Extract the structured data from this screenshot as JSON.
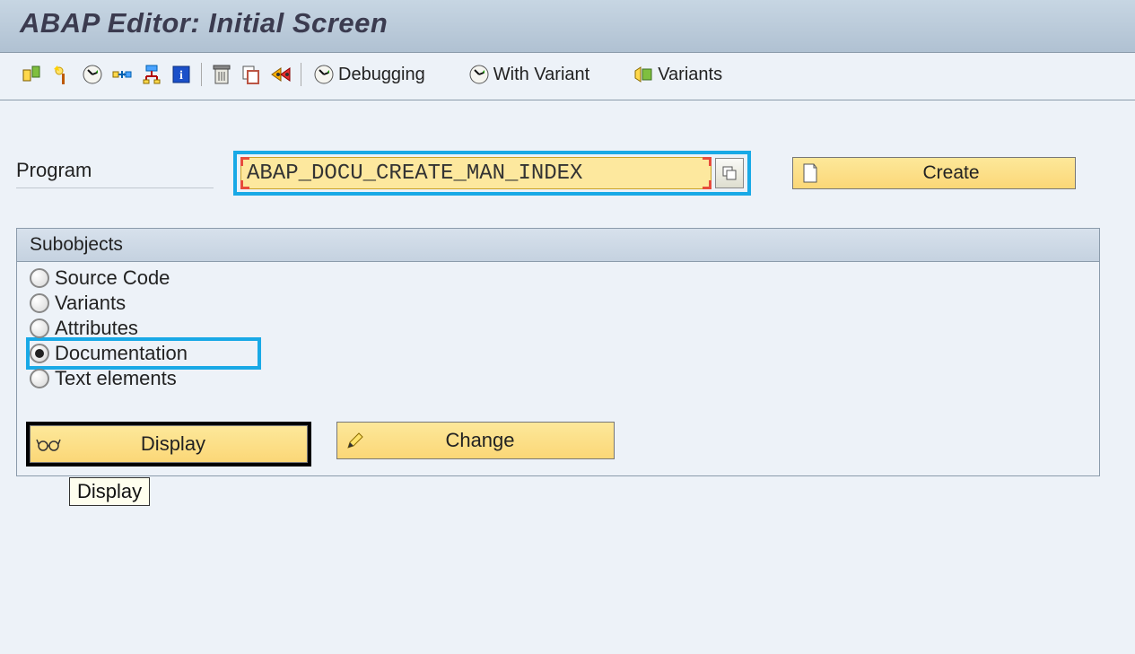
{
  "title": "ABAP Editor: Initial Screen",
  "toolbar": {
    "debugging_label": "Debugging",
    "with_variant_label": "With Variant",
    "variants_label": "Variants"
  },
  "program": {
    "label": "Program",
    "value": "ABAP_DOCU_CREATE_MAN_INDEX"
  },
  "create_button_label": "Create",
  "subobjects": {
    "header": "Subobjects",
    "options": [
      {
        "label": "Source Code",
        "selected": false
      },
      {
        "label": "Variants",
        "selected": false
      },
      {
        "label": "Attributes",
        "selected": false
      },
      {
        "label": "Documentation",
        "selected": true
      },
      {
        "label": "Text elements",
        "selected": false
      }
    ]
  },
  "actions": {
    "display_label": "Display",
    "change_label": "Change"
  },
  "tooltip": "Display"
}
